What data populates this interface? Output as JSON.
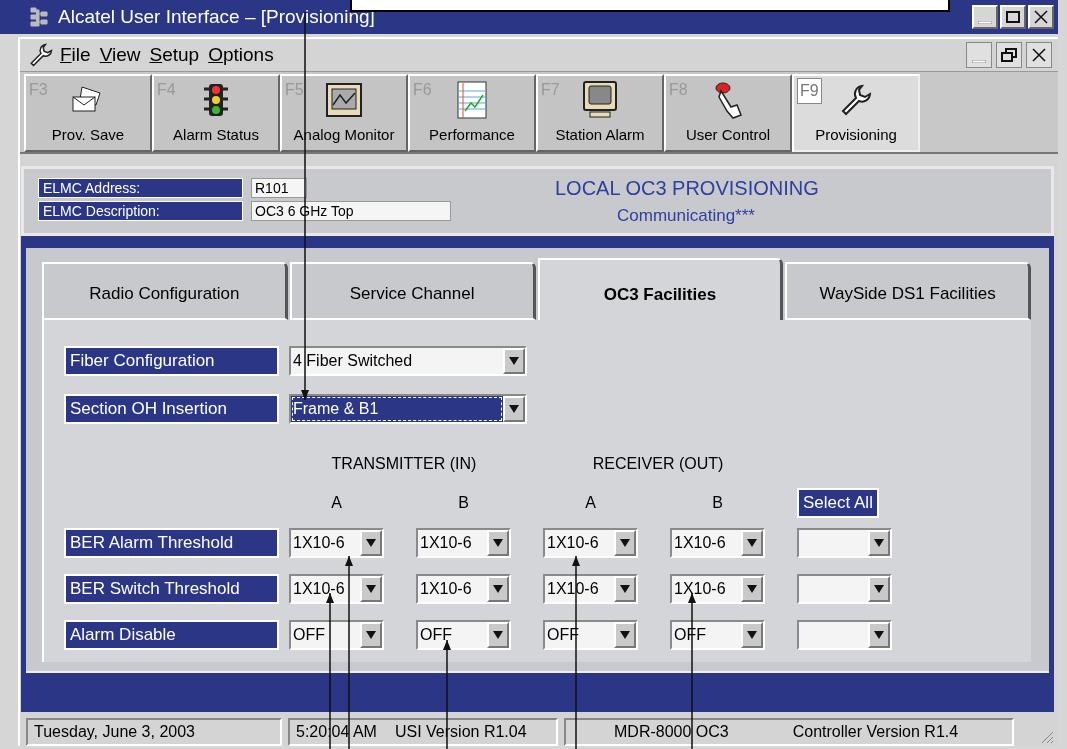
{
  "window": {
    "title": "Alcatel User Interface – [Provisioning]"
  },
  "menu": [
    "File",
    "View",
    "Setup",
    "Options"
  ],
  "toolbar": [
    {
      "key": "F3",
      "label": "Prov. Save",
      "selected": false
    },
    {
      "key": "F4",
      "label": "Alarm Status",
      "selected": false
    },
    {
      "key": "F5",
      "label": "Analog Monitor",
      "selected": false
    },
    {
      "key": "F6",
      "label": "Performance",
      "selected": false
    },
    {
      "key": "F7",
      "label": "Station Alarm",
      "selected": false
    },
    {
      "key": "F8",
      "label": "User Control",
      "selected": false
    },
    {
      "key": "F9",
      "label": "Provisioning",
      "selected": true
    }
  ],
  "header": {
    "fields": [
      {
        "label": "ELMC Address:",
        "value": "R101"
      },
      {
        "label": "ELMC Description:",
        "value": "OC3 6 GHz Top"
      }
    ],
    "title": "LOCAL OC3 PROVISIONING",
    "status": "Communicating***"
  },
  "tabs": [
    {
      "label": "Radio Configuration",
      "selected": false
    },
    {
      "label": "Service Channel",
      "selected": false
    },
    {
      "label": "OC3 Facilities",
      "selected": true
    },
    {
      "label": "WaySide DS1 Facilities",
      "selected": false
    }
  ],
  "settings": [
    {
      "label": "Fiber Configuration",
      "value": "4 Fiber Switched",
      "focused": false
    },
    {
      "label": "Section OH Insertion",
      "value": "Frame & B1",
      "focused": true
    }
  ],
  "groups": [
    "TRANSMITTER (IN)",
    "RECEIVER (OUT)"
  ],
  "columns": [
    "A",
    "B",
    "A",
    "B"
  ],
  "select_all": "Select All",
  "rows": [
    {
      "label": "BER Alarm Threshold",
      "values": [
        "1X10-6",
        "1X10-6",
        "1X10-6",
        "1X10-6"
      ]
    },
    {
      "label": "BER Switch Threshold",
      "values": [
        "1X10-6",
        "1X10-6",
        "1X10-6",
        "1X10-6"
      ]
    },
    {
      "label": "Alarm Disable",
      "values": [
        "OFF",
        "OFF",
        "OFF",
        "OFF"
      ]
    }
  ],
  "status_bar": [
    [
      "Tuesday, June 3, 2003"
    ],
    [
      "5:20:04 AM",
      "USI Version R1.04"
    ],
    [
      "MDR-8000 OC3",
      "Controller Version R1.4"
    ]
  ]
}
